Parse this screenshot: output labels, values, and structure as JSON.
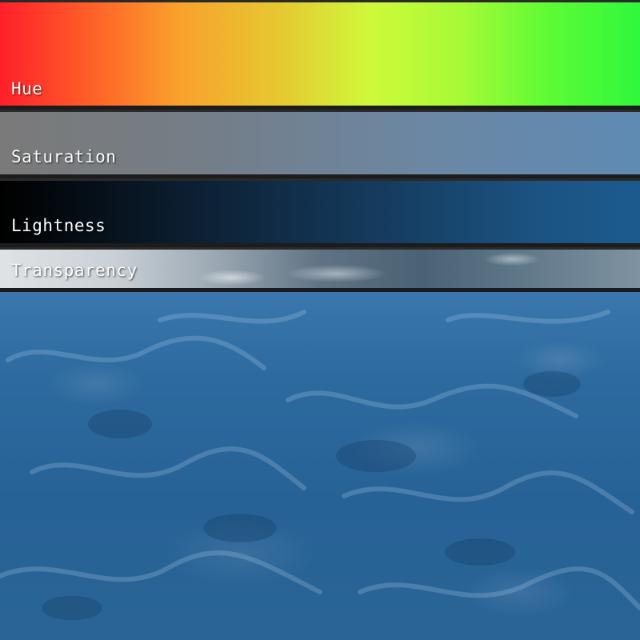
{
  "sliders": {
    "hue": {
      "label": "Hue"
    },
    "saturation": {
      "label": "Saturation"
    },
    "lightness": {
      "label": "Lightness"
    },
    "transparency": {
      "label": "Transparency"
    }
  },
  "colors": {
    "hue_start": "#ff1f2a",
    "hue_end": "#30f83c",
    "ocean": "#2a6497"
  }
}
